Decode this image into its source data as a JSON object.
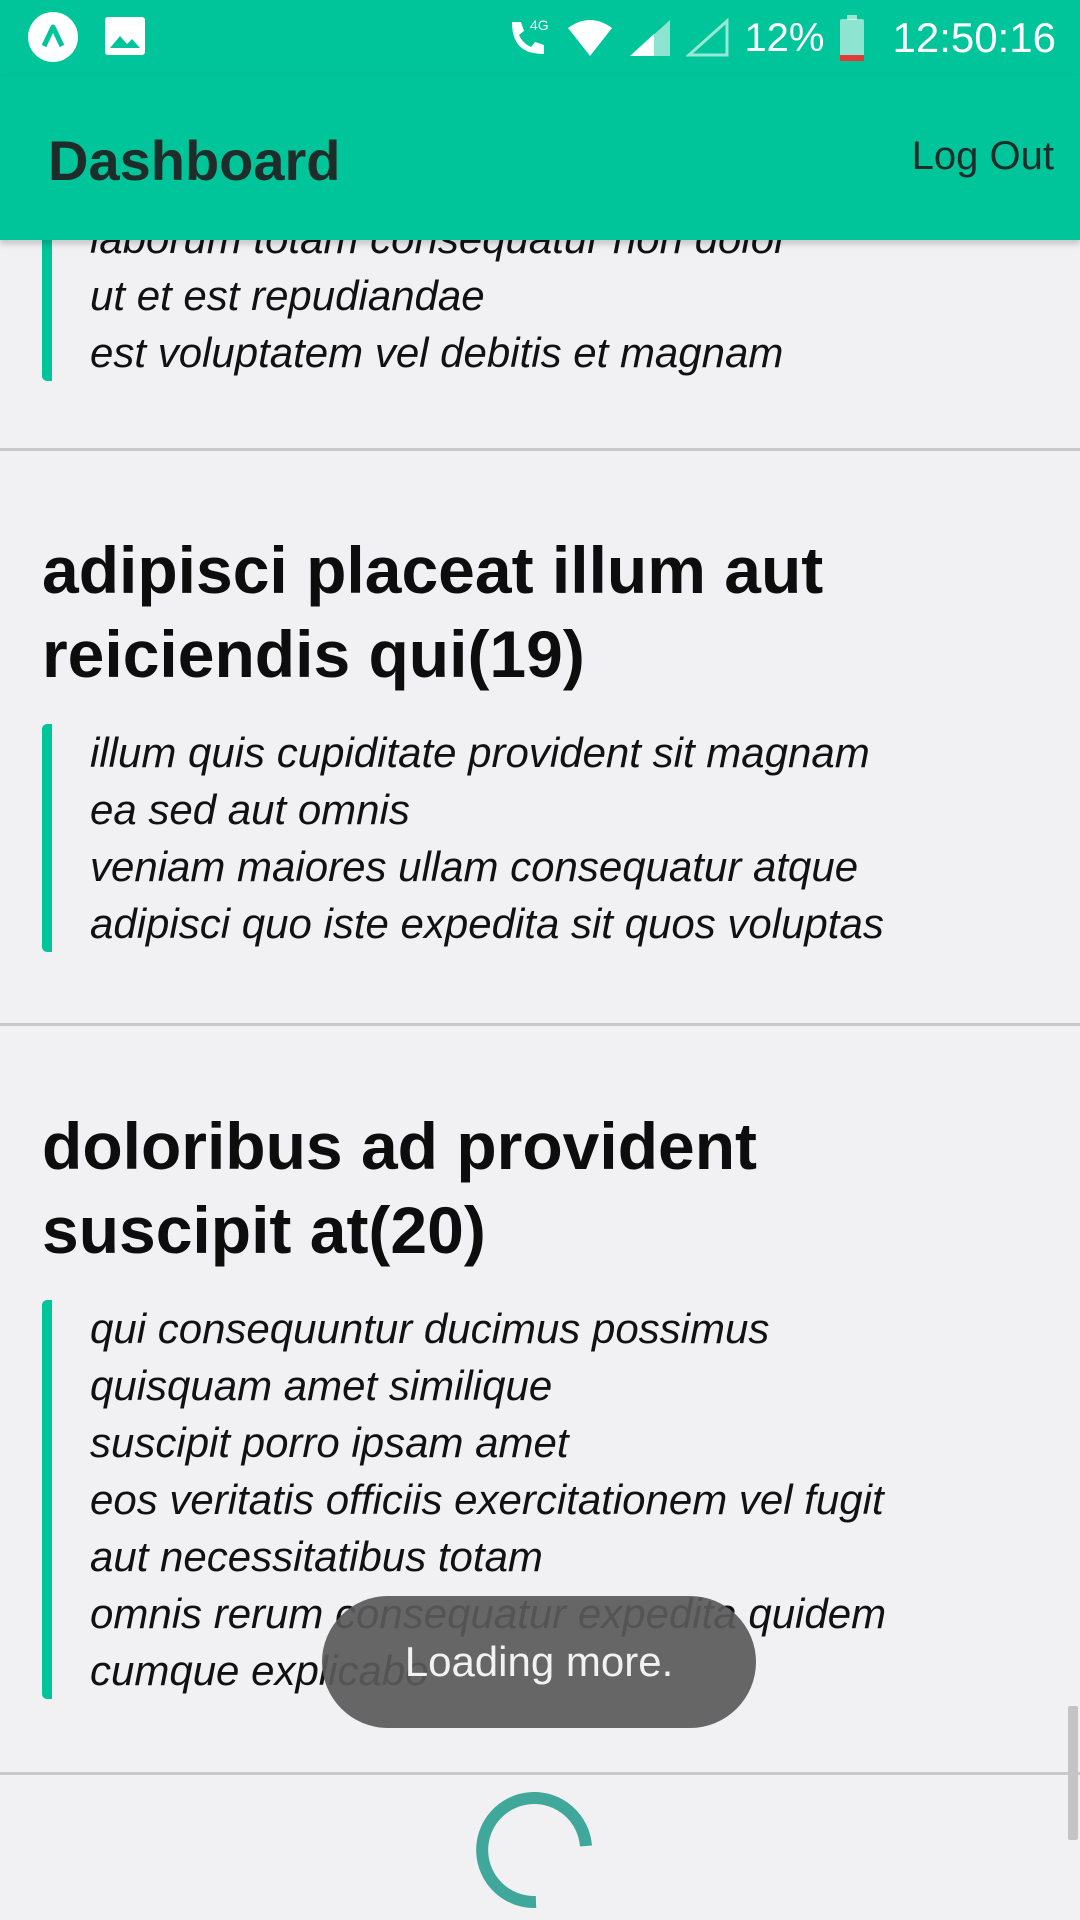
{
  "status_bar": {
    "network_label": "4G",
    "battery_percent": "12%",
    "time": "12:50:16",
    "icons": [
      "app-notification-icon",
      "image-icon",
      "phone-4g-icon",
      "wifi-icon",
      "signal-icon",
      "signal-empty-icon",
      "battery-low-icon"
    ]
  },
  "app_bar": {
    "title": "Dashboard",
    "logout_label": "Log Out"
  },
  "posts": [
    {
      "title": "",
      "body_lines": [
        "laborum totam consequatur non dolor",
        "ut et est repudiandae",
        "est voluptatem vel debitis et magnam"
      ]
    },
    {
      "title": "adipisci placeat illum aut reiciendis qui(19)",
      "body_lines": [
        "illum quis cupiditate provident sit magnam",
        "ea sed aut omnis",
        "veniam maiores ullam consequatur atque",
        "adipisci quo iste expedita sit quos voluptas"
      ]
    },
    {
      "title": "doloribus ad provident suscipit at(20)",
      "body_lines": [
        "qui consequuntur ducimus possimus",
        "quisquam amet similique",
        "suscipit porro ipsam amet",
        "eos veritatis officiis exercitationem vel fugit",
        "aut necessitatibus totam",
        "omnis rerum consequatur expedita quidem",
        "cumque explicabo"
      ]
    }
  ],
  "toast": {
    "message": "Loading more."
  },
  "colors": {
    "accent": "#00c49a",
    "background": "#f1f1f3",
    "spinner": "#3fa89a"
  }
}
